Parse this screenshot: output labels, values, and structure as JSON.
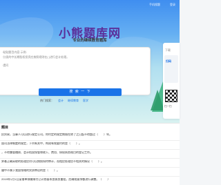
{
  "header": {
    "top_links": [
      "手机搜题",
      "登录"
    ],
    "logo": "小熊题库网",
    "slogan": "专业的继续教育题库"
  },
  "search": {
    "lines": [
      "·粘贴题目内容 示例:",
      "·分类的中长期股权投资应按照规则在(  )进行会计处理。",
      "·提问"
    ],
    "button_label": "搜 索 一 下",
    "hot_label": "热门搜索：",
    "hot_links": [
      "会计",
      "继续教育",
      "医学"
    ]
  },
  "side": {
    "download": "下载",
    "tag": "扫码",
    "scan": "扫一扫"
  },
  "list": {
    "title": "题目",
    "items": [
      "民贸易，当事人可以进行规定公司，你约定的规定期限在除了之日起不得超过（　　）年。",
      "国司法律制度的规定，下列有关中，构成有效要约的是（　　）。",
      "，不得兼管稽核、会计档案保管和收入、费用、债权债务账目的登记工作。",
      "界者正确采取的处理应对可以按照如何审计，而相应处理应不相关的情况（　　）。",
      "履中不属于我国领域的实质审议的是（　　）。",
      "2019年1月1日某借单预缴纳付已计划基本由债务重组，应确视意净额进行调整。（　　）"
    ]
  },
  "colors": {
    "accent": "#1a73e8",
    "logo": "#5b2f9a"
  }
}
